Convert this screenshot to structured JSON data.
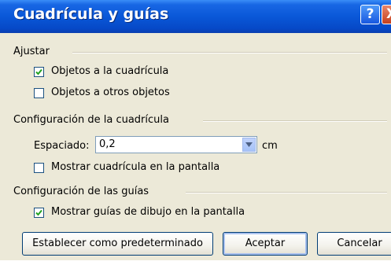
{
  "window": {
    "title": "Cuadrícula y guías"
  },
  "titlebar": {
    "help_label": "?",
    "close_label": "X"
  },
  "groups": {
    "snap": {
      "label": "Ajustar",
      "options": [
        {
          "label": "Objetos a la cuadrícula",
          "checked": true
        },
        {
          "label": "Objetos a otros objetos",
          "checked": false
        }
      ]
    },
    "grid": {
      "label": "Configuración de la cuadrícula",
      "spacing_label": "Espaciado:",
      "spacing_value": "0,2",
      "unit": "cm",
      "show_grid": {
        "label": "Mostrar cuadrícula en la pantalla",
        "checked": false
      }
    },
    "guides": {
      "label": "Configuración de las guías",
      "show_guides": {
        "label": "Mostrar guías de dibujo en la pantalla",
        "checked": true
      }
    }
  },
  "buttons": {
    "set_default": "Establecer como predeterminado",
    "ok": "Aceptar",
    "cancel": "Cancelar"
  }
}
